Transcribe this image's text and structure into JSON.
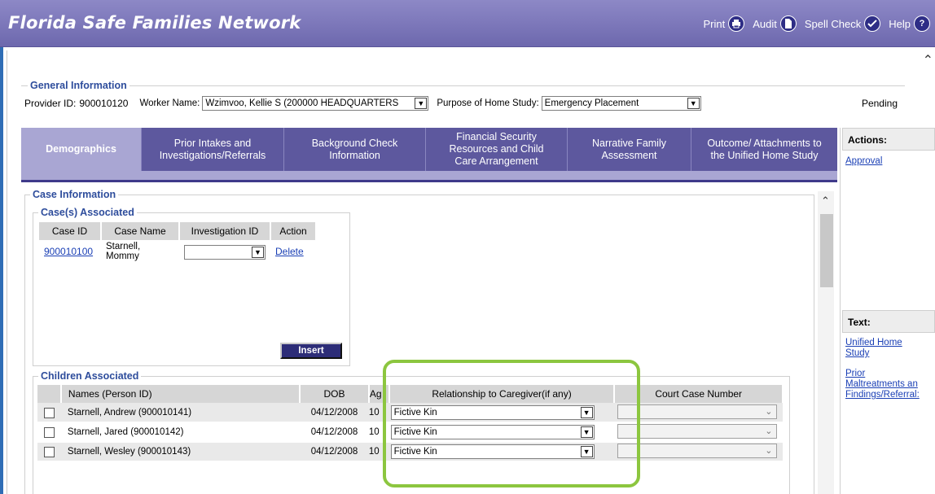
{
  "app": {
    "title": "Florida Safe Families Network",
    "actions": [
      {
        "label": "Print",
        "icon": "printer-icon"
      },
      {
        "label": "Audit",
        "icon": "document-icon"
      },
      {
        "label": "Spell Check",
        "icon": "spell-check-icon"
      },
      {
        "label": "Help",
        "icon": "help-icon",
        "glyph": "?"
      }
    ]
  },
  "general": {
    "legend": "General Information",
    "provider_label": "Provider ID:",
    "provider_id": "900010120",
    "worker_label": "Worker Name:",
    "worker_value": "Wzimvoo, Kellie S (200000 HEADQUARTERS",
    "purpose_label": "Purpose of Home Study:",
    "purpose_value": "Emergency Placement",
    "status": "Pending"
  },
  "tabs": [
    {
      "label": "Demographics",
      "active": true
    },
    {
      "label": "Prior Intakes and Investigations/Referrals",
      "active": false
    },
    {
      "label": "Background Check Information",
      "active": false
    },
    {
      "label": "Financial Security Resources and Child Care Arrangement",
      "active": false
    },
    {
      "label": "Narrative Family Assessment",
      "active": false
    },
    {
      "label": "Outcome/ Attachments to the Unified Home Study",
      "active": false
    }
  ],
  "sidebar": {
    "actions_title": "Actions:",
    "actions": [
      "Approval"
    ],
    "text_title": "Text:",
    "text_links": [
      "Unified Home",
      "Study",
      "Prior",
      "Maltreatments an",
      "Findings/Referral:"
    ]
  },
  "case_info": {
    "legend": "Case Information",
    "cases_legend": "Case(s) Associated",
    "headers": [
      "Case ID",
      "Case Name",
      "Investigation ID",
      "Action"
    ],
    "rows": [
      {
        "case_id": "900010100",
        "case_name": "Starnell, Mommy",
        "investigation_id": "",
        "action": "Delete"
      }
    ],
    "insert_label": "Insert"
  },
  "children": {
    "legend": "Children Associated",
    "headers": [
      "",
      "Names (Person ID)",
      "DOB",
      "Ag",
      "Relationship to Caregiver(if any)",
      "Court Case Number"
    ],
    "rows": [
      {
        "name": "Starnell, Andrew (900010141)",
        "dob": "04/12/2008",
        "age": "10",
        "relationship": "Fictive Kin",
        "court_case": ""
      },
      {
        "name": "Starnell, Jared (900010142)",
        "dob": "04/12/2008",
        "age": "10",
        "relationship": "Fictive Kin",
        "court_case": ""
      },
      {
        "name": "Starnell, Wesley (900010143)",
        "dob": "04/12/2008",
        "age": "10",
        "relationship": "Fictive Kin",
        "court_case": ""
      }
    ]
  },
  "colors": {
    "header": "#7a75b8",
    "tab": "#5d589e",
    "tab_active": "#a9a6d3",
    "link": "#1a3fb5",
    "highlight": "#8cc63f"
  }
}
